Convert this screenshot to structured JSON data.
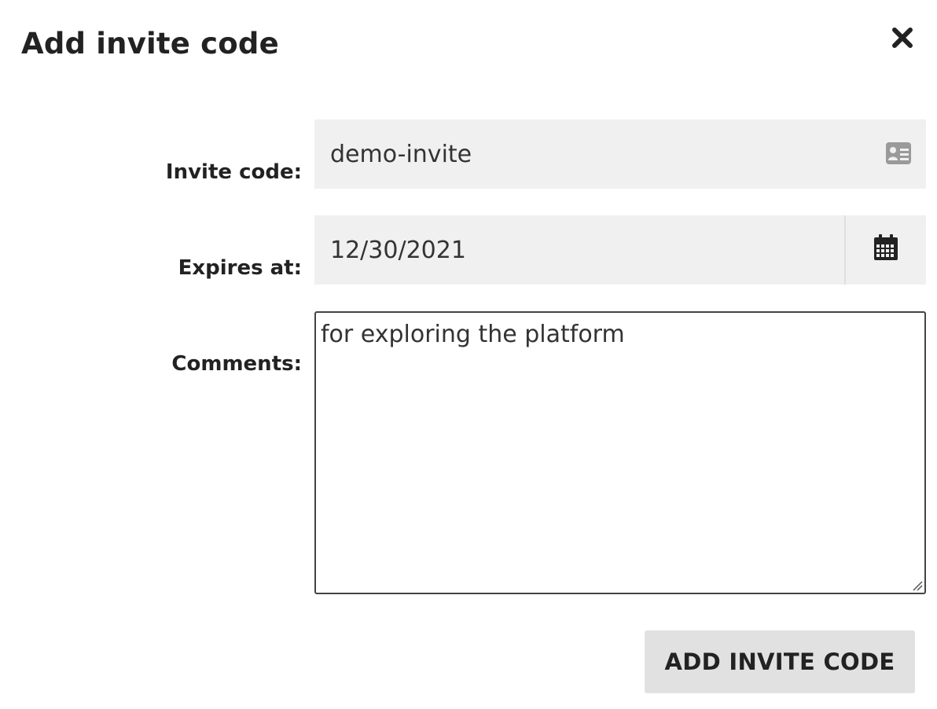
{
  "dialog": {
    "title": "Add invite code",
    "close_icon": "close-icon"
  },
  "form": {
    "invite_code": {
      "label": "Invite code:",
      "value": "demo-invite",
      "icon": "id-card-icon"
    },
    "expires_at": {
      "label": "Expires at:",
      "value": "12/30/2021",
      "icon": "calendar-icon"
    },
    "comments": {
      "label": "Comments:",
      "value": "for exploring the platform"
    }
  },
  "actions": {
    "submit_label": "ADD INVITE CODE"
  },
  "colors": {
    "field_background": "#f0f0f0",
    "button_background": "#e1e1e1",
    "text": "#222222",
    "icon_muted": "#9a9a9a"
  }
}
